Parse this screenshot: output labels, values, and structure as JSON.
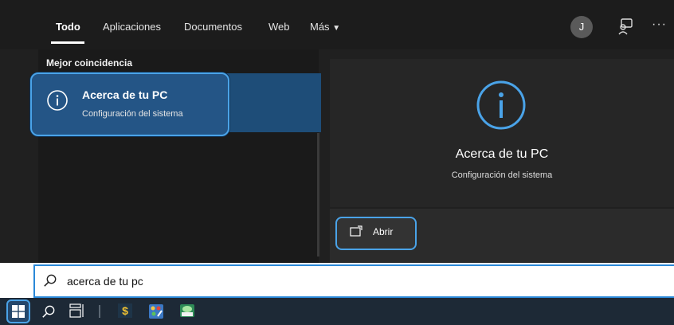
{
  "tabs": [
    {
      "label": "Todo",
      "active": true
    },
    {
      "label": "Aplicaciones"
    },
    {
      "label": "Documentos"
    },
    {
      "label": "Web"
    },
    {
      "label": "Más"
    }
  ],
  "user": {
    "initial": "J"
  },
  "best_match": {
    "heading": "Mejor coincidencia",
    "title": "Acerca de tu PC",
    "subtitle": "Configuración del sistema",
    "icon": "info-icon"
  },
  "preview": {
    "title": "Acerca de tu PC",
    "subtitle": "Configuración del sistema",
    "icon": "info-icon",
    "open_label": "Abrir"
  },
  "search": {
    "value": "acerca de tu pc"
  },
  "colors": {
    "accent": "#4aa3e8",
    "selection": "#245586",
    "panel": "#202020",
    "taskbar": "#1d2936"
  }
}
